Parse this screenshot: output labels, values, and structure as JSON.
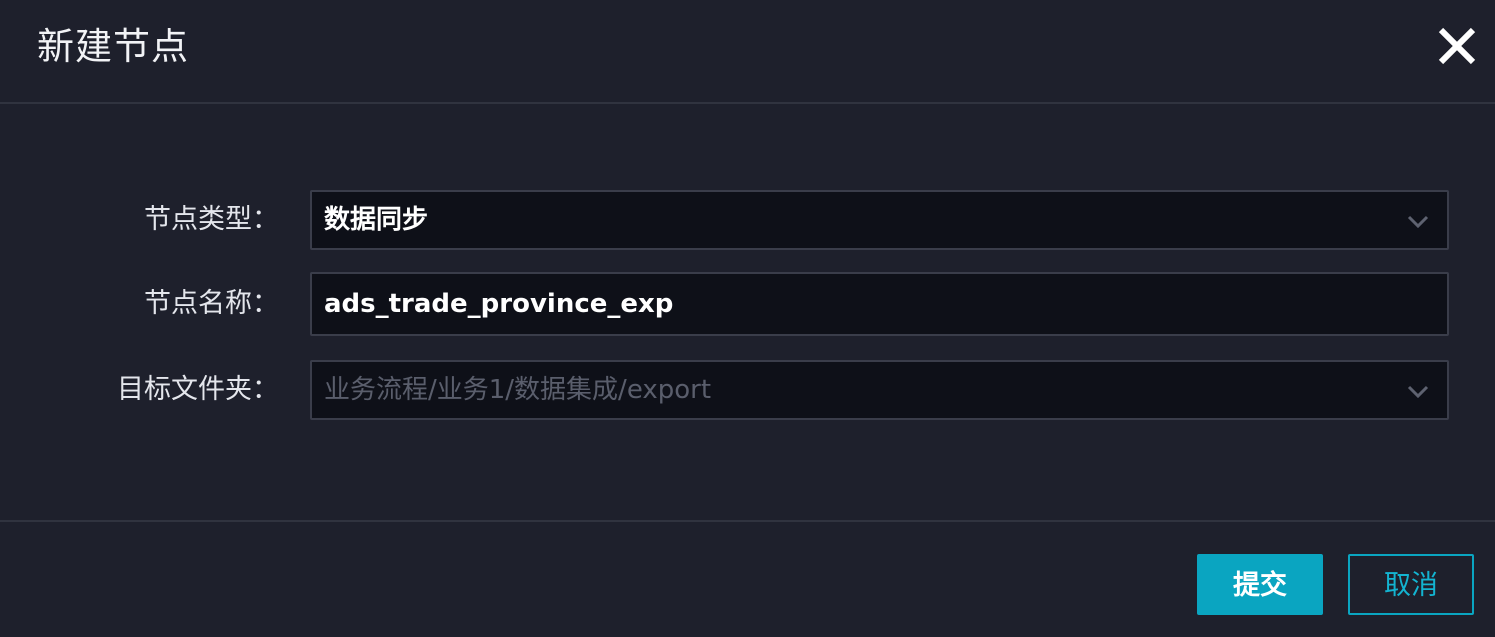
{
  "dialog": {
    "title": "新建节点",
    "close_icon": "close-icon"
  },
  "form": {
    "node_type": {
      "label": "节点类型：",
      "value": "数据同步",
      "icon": "chevron-down-icon"
    },
    "node_name": {
      "label": "节点名称：",
      "value": "ads_trade_province_exp"
    },
    "target_folder": {
      "label": "目标文件夹：",
      "placeholder": "业务流程/业务1/数据集成/export",
      "icon": "chevron-down-icon"
    }
  },
  "footer": {
    "submit_label": "提交",
    "cancel_label": "取消"
  },
  "colors": {
    "background": "#1e202c",
    "field_background": "#0e1018",
    "accent": "#0aa5c1"
  }
}
